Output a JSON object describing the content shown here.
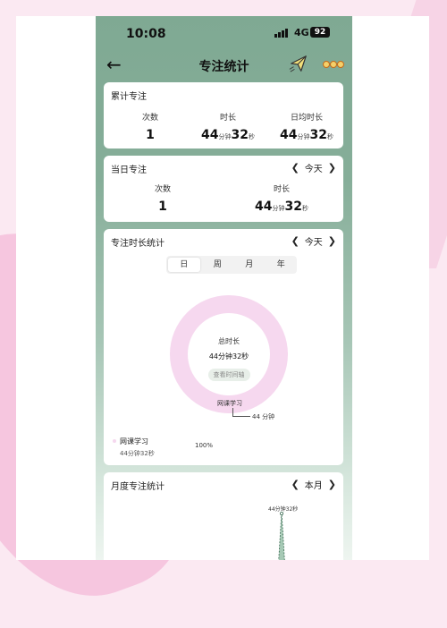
{
  "status_bar": {
    "time": "10:08",
    "network": "4G",
    "battery": "92"
  },
  "header": {
    "title": "专注统计",
    "icons": [
      "back-arrow-icon",
      "paper-plane-icon",
      "more-dots-icon"
    ]
  },
  "cumulative": {
    "title": "累计专注",
    "stats": [
      {
        "label": "次数",
        "value": "1"
      },
      {
        "label": "时长",
        "value": "44",
        "unit1": "分钟",
        "value2": "32",
        "unit2": "秒"
      },
      {
        "label": "日均时长",
        "value": "44",
        "unit1": "分钟",
        "value2": "32",
        "unit2": "秒"
      }
    ]
  },
  "daily": {
    "title": "当日专注",
    "period": "今天",
    "stats": [
      {
        "label": "次数",
        "value": "1"
      },
      {
        "label": "时长",
        "value": "44",
        "unit1": "分钟",
        "value2": "32",
        "unit2": "秒"
      }
    ]
  },
  "duration_stats": {
    "title": "专注时长统计",
    "period": "今天",
    "tabs": [
      "日",
      "周",
      "月",
      "年"
    ],
    "active_tab": "日",
    "donut": {
      "center_label": "总时长",
      "center_value": "44分钟32秒",
      "timeline_button": "查看时间轴",
      "slice_label": "网课学习",
      "slice_value": "44 分钟",
      "color": "#f6d8ef"
    },
    "legend": [
      {
        "name": "网课学习",
        "duration": "44分钟32秒",
        "percent": "100%"
      }
    ]
  },
  "monthly": {
    "title": "月度专注统计",
    "period": "本月",
    "peak_label": "44分钟32秒"
  },
  "colors": {
    "accent": "#7fa993",
    "donut": "#f6d8ef"
  }
}
